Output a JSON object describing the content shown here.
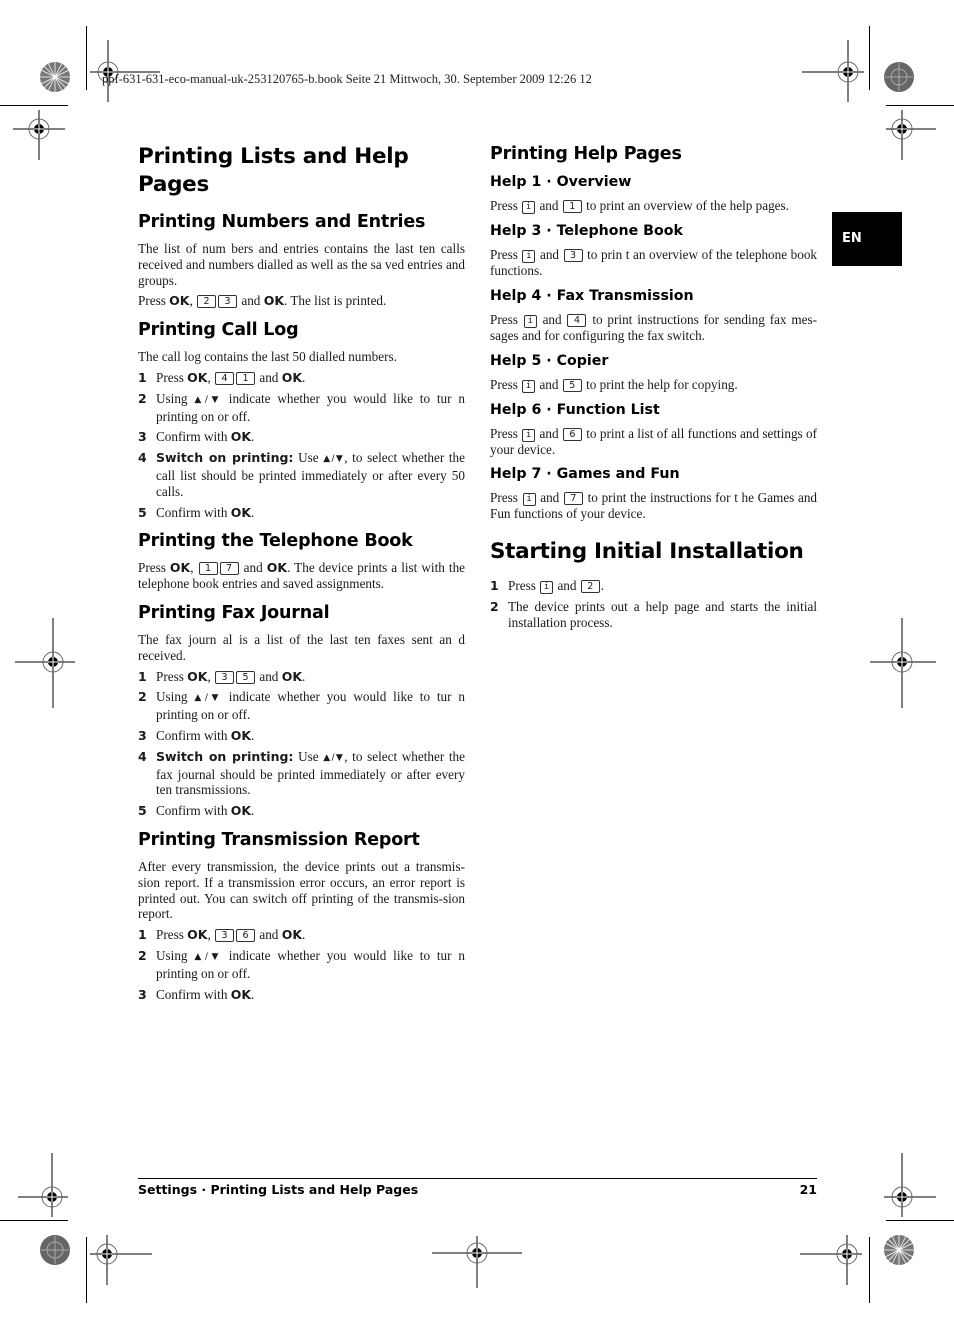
{
  "print_header": "ppf-631-631-eco-manual-uk-253120765-b.book  Seite 21  Mittwoch, 30. September 2009  12:26 12",
  "language_tab": "EN",
  "left": {
    "title": "Printing Lists and Help Pages",
    "numbers": {
      "heading": "Printing Numbers and Entries",
      "body": "The list of num bers and entries contains the last ten calls received and numbers dialled as well as the sa ved entries and groups.",
      "press": "Press",
      "ok": "OK",
      "keys": [
        "2",
        "3"
      ],
      "and": "and",
      "end": ". The list is printed."
    },
    "call_log": {
      "heading": "Printing Call Log",
      "body": "The call log contains the last 50 dialled numbers.",
      "step1": {
        "num": "1",
        "press": "Press",
        "ok": "OK",
        "keys": [
          "4",
          "1"
        ],
        "and": "and"
      },
      "step2": {
        "num": "2",
        "using": "Using",
        "arrows": "▲/▼",
        "text": " indicate whether you  would like to tur n printing on or off."
      },
      "step3": {
        "num": "3",
        "text": "Confirm with ",
        "ok": "OK"
      },
      "step4": {
        "num": "4",
        "bold": "Switch on printing:",
        "use": " Use ",
        "arrows": "▲/▼",
        "text": ", to select whether the call list should be printed immediately or after every 50 calls."
      },
      "step5": {
        "num": "5",
        "text": "Confirm with ",
        "ok": "OK"
      }
    },
    "telephone_book": {
      "heading": "Printing the Telephone Book",
      "press": "Press",
      "ok": "OK",
      "keys": [
        "1",
        "7"
      ],
      "and": "and",
      "end": ". The device prints a list with the telephone book entries and saved assignments."
    },
    "fax_journal": {
      "heading": "Printing Fax Journal",
      "body": "The  fax journ al  is a list   of  the last ten   faxes  sent an d received.",
      "step1": {
        "num": "1",
        "press": "Press",
        "ok": "OK",
        "keys": [
          "3",
          "5"
        ],
        "and": "and"
      },
      "step2": {
        "num": "2",
        "using": "Using",
        "arrows": "▲/▼",
        "text": " indicate whether you  would like to tur n printing on or off."
      },
      "step3": {
        "num": "3",
        "text": "Confirm with ",
        "ok": "OK"
      },
      "step4": {
        "num": "4",
        "bold": "Switch on printing:",
        "use": " Use ",
        "arrows": "▲/▼",
        "text": ", to select whether the fax journal should be printed immediately or after every ten transmissions."
      },
      "step5": {
        "num": "5",
        "text": "Confirm with ",
        "ok": "OK"
      }
    },
    "transmission_report": {
      "heading": "Printing Transmission Report",
      "body": "After every transmission, the device prints out a transmis-sion report. If a transmission error occurs, an error report is printed out. You can switch off printing of the transmis-sion report.",
      "step1": {
        "num": "1",
        "press": "Press",
        "ok": "OK",
        "keys": [
          "3",
          "6"
        ],
        "and": "and"
      },
      "step2": {
        "num": "2",
        "using": "Using",
        "arrows": "▲/▼",
        "text": " indicate whether you  would like to tur n printing on or off."
      },
      "step3": {
        "num": "3",
        "text": "Confirm with ",
        "ok": "OK"
      }
    }
  },
  "right": {
    "title": "Printing Help Pages",
    "info_key": "i",
    "help_items": [
      {
        "heading": "Help 1 · Overview",
        "key": "1",
        "text": " to print an overview of the help pages."
      },
      {
        "heading": "Help 3 · Telephone Book",
        "key": "3",
        "text": " to prin t an overview of the telephone book functions."
      },
      {
        "heading": "Help 4 · Fax Transmission",
        "key": "4",
        "text": " to print instructions for sending fax mes-sages and for configuring the fax switch."
      },
      {
        "heading": "Help 5 · Copier",
        "key": "5",
        "text": " to print the help for copying."
      },
      {
        "heading": "Help 6 · Function List",
        "key": "6",
        "text": " to print a list of all functions and settings of your device."
      },
      {
        "heading": "Help 7 · Games and Fun",
        "key": "7",
        "text": " to print the instructions for t he Games and Fun functions of your device."
      }
    ],
    "press": "Press",
    "and": "and",
    "installation": {
      "heading": "Starting Initial Installation",
      "step1": {
        "num": "1",
        "press": "Press",
        "and": "and",
        "key": "2",
        "end": "."
      },
      "step2": {
        "num": "2",
        "text": "The device prints out a help page and starts the initial installation process."
      }
    }
  },
  "footer": {
    "section": "Settings  · Printing Lists and Help Pages",
    "page_number": "21"
  }
}
